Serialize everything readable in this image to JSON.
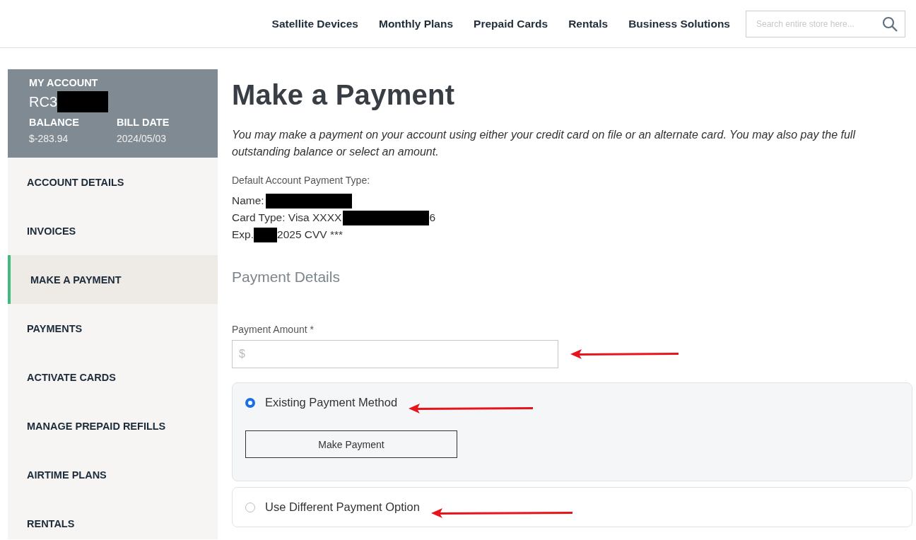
{
  "header": {
    "nav": [
      "Satellite Devices",
      "Monthly Plans",
      "Prepaid Cards",
      "Rentals",
      "Business Solutions"
    ],
    "search": {
      "placeholder": "Search entire store here..."
    }
  },
  "sidebar": {
    "account": {
      "heading": "MY ACCOUNT",
      "number": "RC3",
      "number_redacted": true,
      "balance_label": "BALANCE",
      "balance": "$-283.94",
      "bill_date_label": "BILL DATE",
      "bill_date": "2024/05/03"
    },
    "items": [
      {
        "label": "ACCOUNT DETAILS",
        "selected": false
      },
      {
        "label": "INVOICES",
        "selected": false
      },
      {
        "label": "MAKE A PAYMENT",
        "selected": true
      },
      {
        "label": "PAYMENTS",
        "selected": false
      },
      {
        "label": "ACTIVATE CARDS",
        "selected": false
      },
      {
        "label": "MANAGE PREPAID REFILLS",
        "selected": false
      },
      {
        "label": "AIRTIME PLANS",
        "selected": false
      },
      {
        "label": "RENTALS",
        "selected": false
      }
    ]
  },
  "main": {
    "title": "Make a Payment",
    "intro": "You may make a payment on your account using either your credit card on file or an alternate card. You may also pay the full outstanding balance or select an amount.",
    "default_label": "Default Account Payment Type:",
    "payment_lines": [
      [
        {
          "kind": "text",
          "text": "Name:"
        },
        {
          "kind": "redaction"
        }
      ],
      [
        {
          "kind": "text",
          "text": "Card Type: Visa XXXX"
        },
        {
          "kind": "redaction"
        },
        {
          "kind": "text",
          "text": "6"
        }
      ],
      [
        {
          "kind": "text",
          "text": "Exp."
        },
        {
          "kind": "redaction"
        },
        {
          "kind": "text",
          "text": "2025 CVV ***"
        }
      ]
    ],
    "section_title": "Payment Details",
    "amount": {
      "label": "Payment Amount *",
      "placeholder": "$",
      "arrow": true
    },
    "options": [
      {
        "label": "Existing Payment Method",
        "selected": true,
        "expanded": true,
        "button": "Make Payment",
        "arrow": true
      },
      {
        "label": "Use Different Payment Option",
        "selected": false,
        "expanded": false,
        "arrow": true
      }
    ]
  }
}
